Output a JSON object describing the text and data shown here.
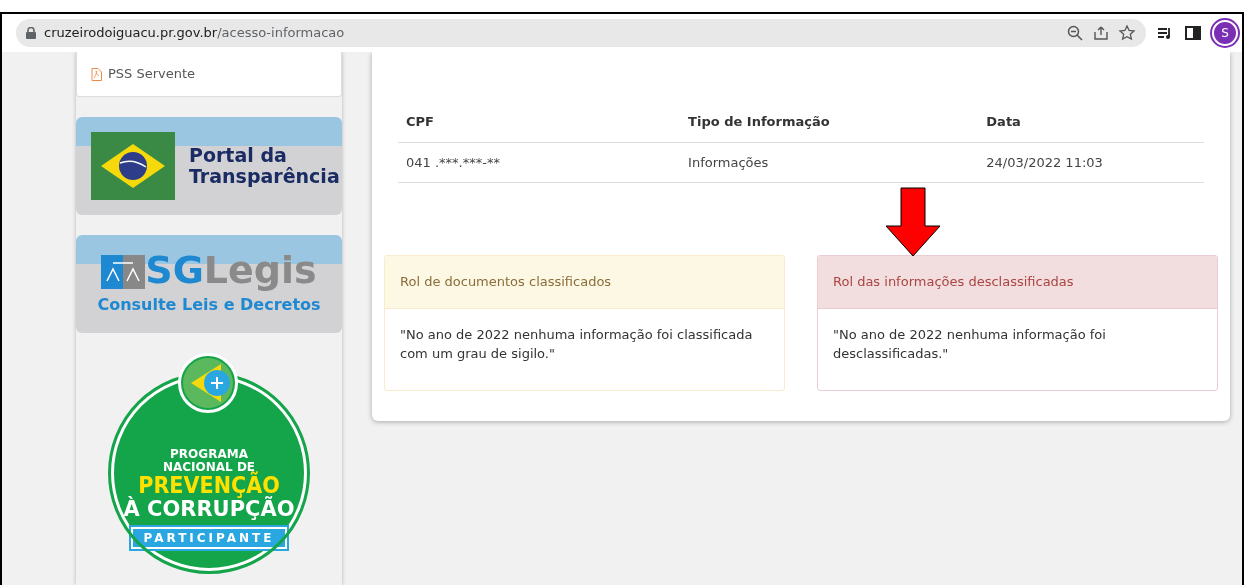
{
  "browser": {
    "url_domain": "cruzeirodoiguacu.pr.gov.br",
    "url_path": "/acesso-informacao",
    "profile_initial": "S"
  },
  "sidebar": {
    "document_link": "PSS Servente",
    "transparency_banner": {
      "line1": "Portal da",
      "line2": "Transparência"
    },
    "sglegis_banner": {
      "logo_sg": "SG",
      "logo_legis": "Legis",
      "subtitle": "Consulte Leis e Decretos"
    },
    "seal": {
      "line1": "PROGRAMA",
      "line2": "NACIONAL DE",
      "line3": "PREVENÇÃO",
      "line4": "À CORRUPÇÃO",
      "ribbon": "PARTICIPANTE"
    }
  },
  "table": {
    "columns": [
      "CPF",
      "Tipo de Informação",
      "Data"
    ],
    "rows": [
      [
        "041 .***.***-**",
        "Informações",
        "24/03/2022 11:03"
      ]
    ]
  },
  "panels": [
    {
      "kind": "warning",
      "title": "Rol de documentos classificados",
      "body": "\"No ano de 2022 nenhuma informação foi classificada com um grau de sigilo.\"",
      "arrow": false
    },
    {
      "kind": "danger",
      "title": "Rol das informações desclassificadas",
      "body": "\"No ano de 2022 nenhuma informação foi desclassificadas.\"",
      "arrow": true
    }
  ]
}
